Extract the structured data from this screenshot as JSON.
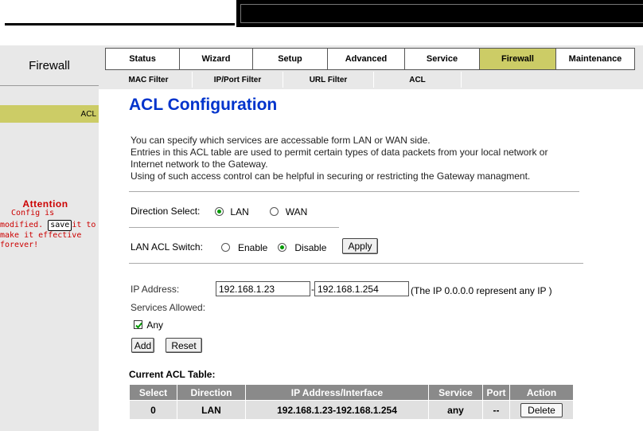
{
  "section": {
    "label": "Firewall"
  },
  "main_tabs": [
    {
      "label": "Status"
    },
    {
      "label": "Wizard"
    },
    {
      "label": "Setup"
    },
    {
      "label": "Advanced"
    },
    {
      "label": "Service"
    },
    {
      "label": "Firewall"
    },
    {
      "label": "Maintenance"
    }
  ],
  "sub_tabs": [
    {
      "label": "MAC Filter"
    },
    {
      "label": "IP/Port Filter"
    },
    {
      "label": "URL Filter"
    },
    {
      "label": "ACL"
    }
  ],
  "sidebar": {
    "acl_label": "ACL"
  },
  "attention": {
    "title": "Attention",
    "line1": "Config is",
    "line2_pre": "modified.",
    "save_label": "save",
    "line2_post": "it to",
    "line3": "make it effective",
    "line4": "forever!"
  },
  "page": {
    "title": "ACL Configuration",
    "desc1": "You can specify which services are accessable form LAN or WAN side.",
    "desc2": "Entries in this ACL table are used to permit certain types of data packets from your local network or",
    "desc3": "Internet network to the Gateway.",
    "desc4": "Using of such access control can be helpful in securing or restricting the Gateway managment."
  },
  "direction": {
    "label": "Direction Select:",
    "options": [
      {
        "label": "LAN",
        "checked": true
      },
      {
        "label": "WAN",
        "checked": false
      }
    ]
  },
  "switch": {
    "label": "LAN ACL Switch:",
    "options": [
      {
        "label": "Enable",
        "checked": false
      },
      {
        "label": "Disable",
        "checked": true
      }
    ],
    "apply_label": "Apply"
  },
  "ip": {
    "label": "IP Address:",
    "start": "192.168.1.23",
    "separator": "-",
    "end": "192.168.1.254",
    "hint": "(The IP 0.0.0.0 represent any IP )"
  },
  "services": {
    "label": "Services Allowed:",
    "any_label": "Any",
    "any_checked": true
  },
  "buttons": {
    "add": "Add",
    "reset": "Reset"
  },
  "table": {
    "caption": "Current ACL Table:",
    "headers": [
      "Select",
      "Direction",
      "IP Address/Interface",
      "Service",
      "Port",
      "Action"
    ],
    "rows": [
      {
        "select": "0",
        "direction": "LAN",
        "ip": "192.168.1.23-192.168.1.254",
        "service": "any",
        "port": "--",
        "action": "Delete"
      }
    ]
  },
  "colors": {
    "accent": "#cccc66",
    "title_blue": "#0033cc",
    "attention_red": "#cc0000"
  }
}
